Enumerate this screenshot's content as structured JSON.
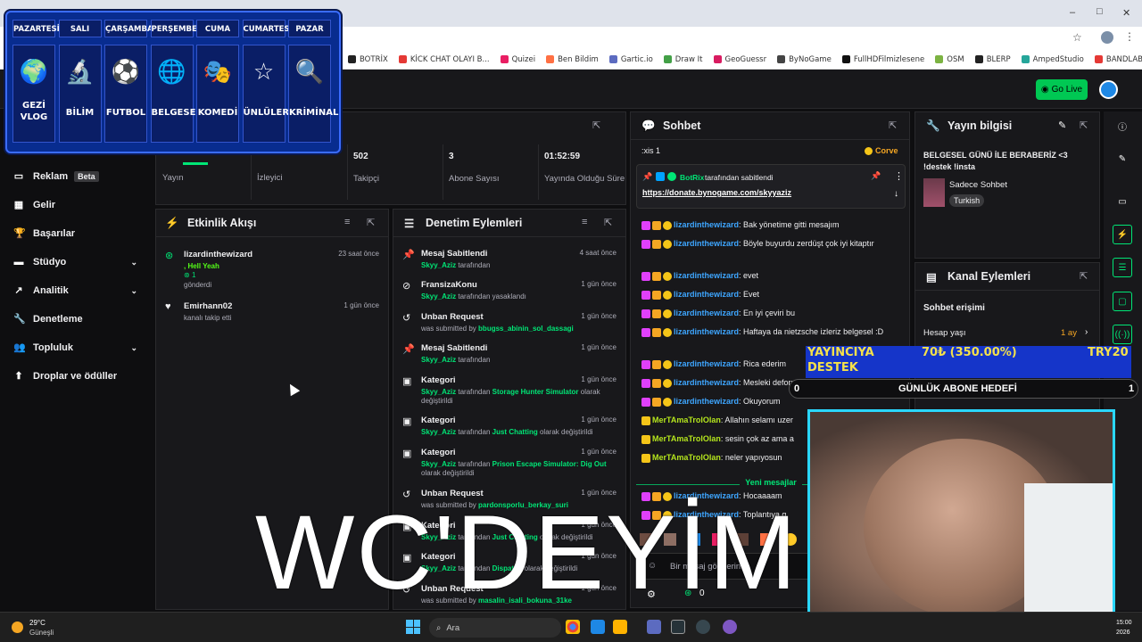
{
  "browser": {
    "bookmarks": [
      {
        "label": "BOTRİX",
        "color": "#222"
      },
      {
        "label": "KİCK CHAT OLAYI B...",
        "color": "#e53935"
      },
      {
        "label": "Quizei",
        "color": "#e91e63"
      },
      {
        "label": "Ben Bildim",
        "color": "#ff7043"
      },
      {
        "label": "Gartic.io",
        "color": "#5c6bc0"
      },
      {
        "label": "Draw It",
        "color": "#43a047"
      },
      {
        "label": "GeoGuessr",
        "color": "#d81b60"
      },
      {
        "label": "ByNoGame",
        "color": "#444"
      },
      {
        "label": "FullHDFilmizlesene",
        "color": "#111"
      },
      {
        "label": "OSM",
        "color": "#7cb342"
      },
      {
        "label": "BLERP",
        "color": "#222"
      },
      {
        "label": "AmpedStudio",
        "color": "#26a69a"
      },
      {
        "label": "BANDLAB",
        "color": "#e53935"
      }
    ],
    "window_controls": {
      "min": "–",
      "max": "□",
      "close": "✕"
    }
  },
  "header": {
    "go_live": "Go Live"
  },
  "schedule": {
    "days": [
      "PAZARTESİ",
      "SALI",
      "ÇARŞAMBA",
      "PERŞEMBE",
      "CUMA",
      "CUMARTESİ",
      "PAZAR"
    ],
    "themes": [
      {
        "label": "GEZİ\nVLOG",
        "icon": "🌍"
      },
      {
        "label": "BİLİM",
        "icon": "🔬"
      },
      {
        "label": "FUTBOL",
        "icon": "⚽"
      },
      {
        "label": "BELGESEL",
        "icon": "🌐"
      },
      {
        "label": "KOMEDİ",
        "icon": "🎭"
      },
      {
        "label": "ÜNLÜLER",
        "icon": "☆"
      },
      {
        "label": "KRİMİNAL",
        "icon": "🔍"
      }
    ]
  },
  "sidebar": {
    "items": [
      {
        "label": "Reklam",
        "badge": "Beta",
        "icon": "▭"
      },
      {
        "label": "Gelir",
        "icon": "▦"
      },
      {
        "label": "Başarılar",
        "icon": "🏆"
      },
      {
        "label": "Stüdyo",
        "icon": "▬",
        "chevron": "⌄"
      },
      {
        "label": "Analitik",
        "icon": "↗",
        "chevron": "⌄"
      },
      {
        "label": "Denetleme",
        "icon": "🔧"
      },
      {
        "label": "Topluluk",
        "icon": "👥",
        "chevron": "⌄"
      },
      {
        "label": "Droplar ve ödüller",
        "icon": "⬆"
      }
    ]
  },
  "stats": {
    "items": [
      {
        "value": "",
        "label": "Yayın"
      },
      {
        "value": "",
        "label": "İzleyici"
      },
      {
        "value": "502",
        "label": "Takipçi"
      },
      {
        "value": "3",
        "label": "Abone Sayısı"
      },
      {
        "value": "01:52:59",
        "label": "Yayında Olduğu Süre"
      }
    ]
  },
  "activity": {
    "title": "Etkinlik Akışı",
    "items": [
      {
        "user": "lizardinthewizard",
        "msg": ", Hell Yeah",
        "count": "1",
        "suffix": "gönderdi",
        "time": "23 saat önce"
      },
      {
        "user": "Emirhann02",
        "msg": "kanalı takip etti",
        "time": "1 gün önce"
      }
    ]
  },
  "moderation": {
    "title": "Denetim Eylemleri",
    "items": [
      {
        "title": "Mesaj Sabitlendi",
        "time": "4 saat önce",
        "by": "Skyy_Aziz",
        "rest": "tarafından",
        "icon": "📌"
      },
      {
        "title": "FransizaKonu",
        "time": "1 gün önce",
        "by": "Skyy_Aziz",
        "rest": "tarafından yasaklandı",
        "icon": "⊘"
      },
      {
        "title": "Unban Request",
        "time": "1 gün önce",
        "pre": "was submitted by",
        "by": "bbugss_abinin_sol_dassagi",
        "icon": "↺"
      },
      {
        "title": "Mesaj Sabitlendi",
        "time": "1 gün önce",
        "by": "Skyy_Aziz",
        "rest": "tarafından",
        "icon": "📌"
      },
      {
        "title": "Kategori",
        "time": "1 gün önce",
        "by": "Skyy_Aziz",
        "mid": "tarafından",
        "cat": "Storage Hunter Simulator",
        "rest": "olarak değiştirildi",
        "icon": "▣"
      },
      {
        "title": "Kategori",
        "time": "1 gün önce",
        "by": "Skyy_Aziz",
        "mid": "tarafından",
        "cat": "Just Chatting",
        "rest": "olarak değiştirildi",
        "icon": "▣"
      },
      {
        "title": "Kategori",
        "time": "1 gün önce",
        "by": "Skyy_Aziz",
        "mid": "tarafından",
        "cat": "Prison Escape Simulator: Dig Out",
        "rest": "olarak değiştirildi",
        "icon": "▣"
      },
      {
        "title": "Unban Request",
        "time": "1 gün önce",
        "pre": "was submitted by",
        "by": "pardonsporlu_berkay_suri",
        "icon": "↺"
      },
      {
        "title": "Kategori",
        "time": "1 gün önce",
        "by": "Skyy_Aziz",
        "mid": "tarafından",
        "cat": "Just Chatting",
        "rest": "olarak değiştirildi",
        "icon": "▣"
      },
      {
        "title": "Kategori",
        "time": "1 gün önce",
        "by": "Skyy_Aziz",
        "mid": "tarafından",
        "cat": "Dispatch",
        "rest": "olarak değiştirildi",
        "icon": "▣"
      },
      {
        "title": "Unban Request",
        "time": "1 gün önce",
        "pre": "was submitted by",
        "by": "masalin_isali_bokuna_31ke",
        "icon": "↺"
      }
    ]
  },
  "chat": {
    "title": "Sohbet",
    "top_partial": ":xis 1",
    "top_user": "Corve",
    "pinned": {
      "user": "BotRix",
      "label": "tarafından sabitlendi",
      "link": "https://donate.bynogame.com/skyyaziz"
    },
    "messages": [
      {
        "user": "lizardinthewizard",
        "text": ": Bak yönetime gitti mesajım",
        "color": "#3ea6ff"
      },
      {
        "user": "lizardinthewizard",
        "text": ": Böyle buyurdu zerdüşt çok iyi kitaptır",
        "color": "#3ea6ff"
      },
      {
        "user": "lizardinthewizard",
        "text": ": evet",
        "color": "#3ea6ff"
      },
      {
        "user": "lizardinthewizard",
        "text": ": Evet",
        "color": "#3ea6ff"
      },
      {
        "user": "lizardinthewizard",
        "text": ": En iyi çeviri bu",
        "color": "#3ea6ff"
      },
      {
        "user": "lizardinthewizard",
        "text": ": Haftaya da nietzsche izleriz belgesel :D",
        "color": "#3ea6ff"
      },
      {
        "user": "lizardinthewizard",
        "text": ": Rica ederim",
        "color": "#3ea6ff"
      },
      {
        "user": "lizardinthewizard",
        "text": ": Mesleki deformasyon",
        "color": "#3ea6ff"
      },
      {
        "user": "lizardinthewizard",
        "text": ": Okuyorum",
        "color": "#3ea6ff"
      },
      {
        "user": "MerTAmaTrolOlan",
        "text": ": Allahın selamı uzer",
        "color": "#b5e61d"
      },
      {
        "user": "MerTAmaTrolOlan",
        "text": ": sesin çok az ama a",
        "color": "#b5e61d"
      },
      {
        "user": "MerTAmaTrolOlan",
        "text": ": neler yapıyosun",
        "color": "#b5e61d"
      },
      {
        "user": "lizardinthewizard",
        "text": ": Hocaaaam",
        "color": "#3ea6ff"
      },
      {
        "user": "lizardinthewizard",
        "text": ": Toplantıya g",
        "color": "#3ea6ff"
      }
    ],
    "new_messages": "Yeni mesajlar",
    "input_placeholder": "Bir mesaj gönderin",
    "footer_count": "0"
  },
  "info": {
    "title": "Yayın bilgisi",
    "stream_title": "BELGESEL GÜNÜ İLE BERABERİZ <3 !destek !insta",
    "category": "Sadece Sohbet",
    "language": "Turkish"
  },
  "actions": {
    "title": "Kanal Eylemleri",
    "chat_access": "Sohbet erişimi",
    "account_age": "Hesap yaşı",
    "account_age_value": "1 ay"
  },
  "overlays": {
    "goal_left": "YAYINCIYA DESTEK",
    "goal_mid": "70₺ (350.00%)",
    "goal_right": "TRY20",
    "sub_goal_label": "GÜNLÜK ABONE HEDEFİ",
    "sub_goal_left": "0",
    "sub_goal_right": "1",
    "big_text": "WC'DEYİM"
  },
  "taskbar": {
    "weather_temp": "29°C",
    "weather_desc": "Güneşli",
    "search": "Ara",
    "time": "15:00",
    "date": "2026"
  },
  "colors": {
    "accent": "#00e676",
    "kick_green": "#53fc18",
    "link": "#3ea6ff",
    "overlay_blue": "#1535c9"
  }
}
